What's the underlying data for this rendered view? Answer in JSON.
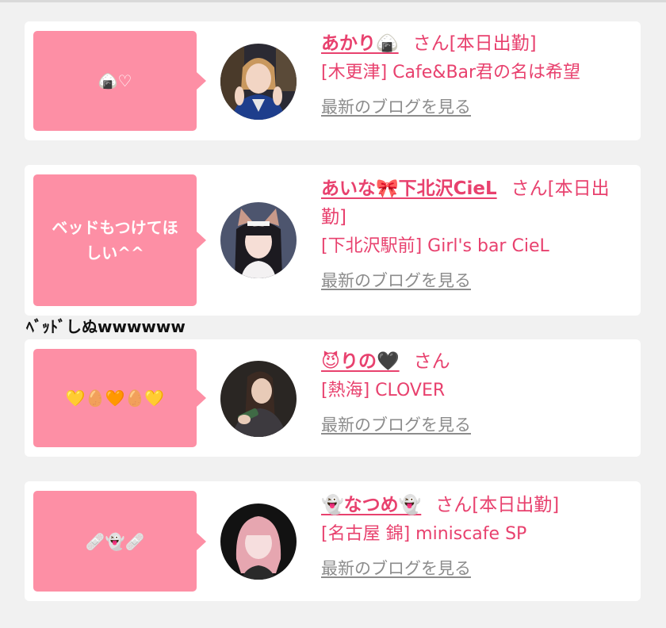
{
  "cards": [
    {
      "bubble": "🍙♡",
      "name": "あかり🍙",
      "suffix": "さん[本日出勤]",
      "shop": "[木更津] Cafe&Bar君の名は希望",
      "blog_link": "最新のブログを見る",
      "avatar_icon": "avatar-photo"
    },
    {
      "bubble": "ベッドもつけてほしい^^",
      "name": "あいな🎀下北沢CieL",
      "suffix": "さん[本日出勤]",
      "shop": "[下北沢駅前] Girl's bar CieL",
      "blog_link": "最新のブログを見る",
      "avatar_icon": "avatar-photo"
    },
    {
      "bubble": "💛🥚🧡🥚💛",
      "name": "😈りの🖤",
      "suffix": "さん",
      "shop": "[熱海] CLOVER",
      "blog_link": "最新のブログを見る",
      "avatar_icon": "avatar-photo"
    },
    {
      "bubble": "🩹👻🩹",
      "name": "👻なつめ👻",
      "suffix": "さん[本日出勤]",
      "shop": "[名古屋 錦] miniscafe SP",
      "blog_link": "最新のブログを見る",
      "avatar_icon": "avatar-photo"
    }
  ],
  "stray_text": "ﾍﾞｯﾄﾞしぬwwwwww",
  "colors": {
    "accent": "#e8416e",
    "bubble": "#fd8fa5",
    "link": "#8c8c8c",
    "background": "#f1f1f1"
  }
}
